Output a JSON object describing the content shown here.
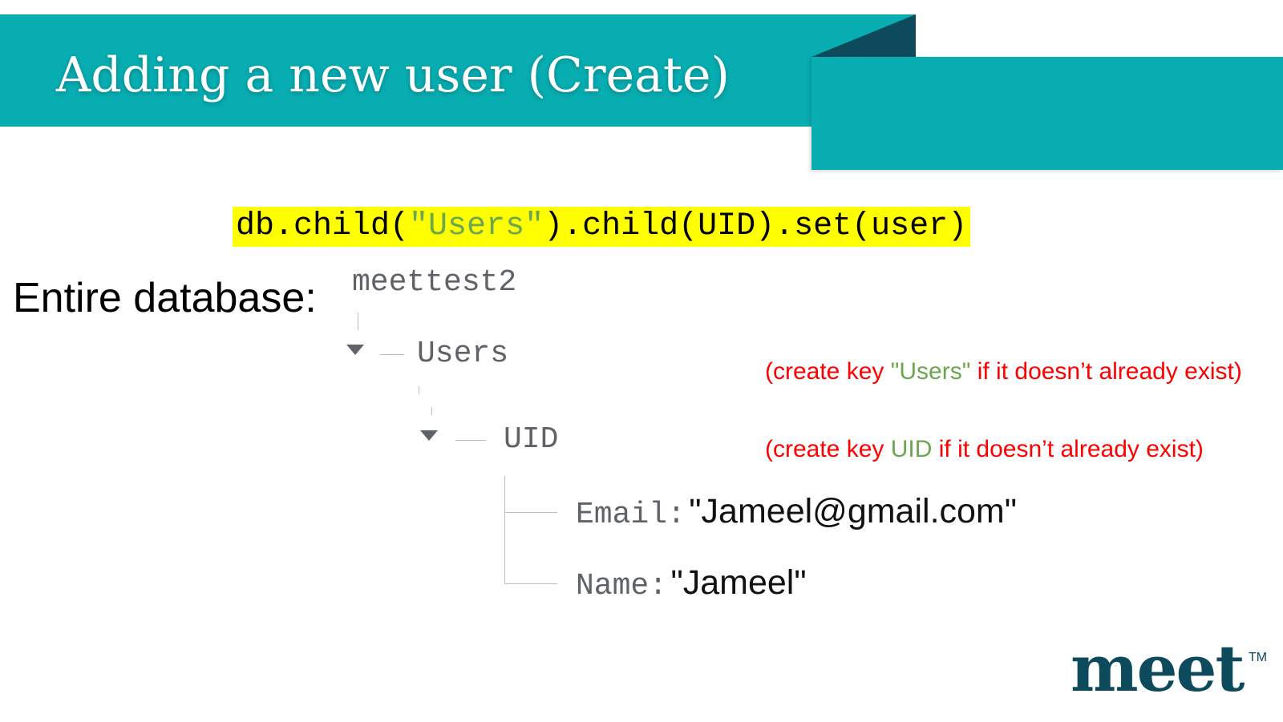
{
  "slide": {
    "title": "Adding a new user (Create)",
    "code": {
      "before": "db.child(",
      "string": "\"Users\"",
      "after": ").child(UID).set(user)"
    },
    "label": "Entire database:",
    "tree": {
      "root": "meettest2",
      "level1": "Users",
      "level2": "UID",
      "fields": [
        {
          "key": "Email:",
          "value": "\"Jameel@gmail.com\""
        },
        {
          "key": "Name:",
          "value": "\"Jameel\""
        }
      ]
    },
    "notes": [
      {
        "pre": "(create key ",
        "highlight": "\"Users\"",
        "post": " if it doesn’t already exist)"
      },
      {
        "pre": "(create key ",
        "highlight": "UID",
        "post": " if it doesn’t already exist)"
      }
    ],
    "logo": "meet",
    "trademark": "TM"
  },
  "colors": {
    "banner": "#07adb1",
    "banner_fold": "#0d4a5c",
    "code_highlight": "#ffff00",
    "note_text": "#ff0000",
    "note_highlight": "#6aa84f",
    "logo": "#0d4a5c"
  }
}
